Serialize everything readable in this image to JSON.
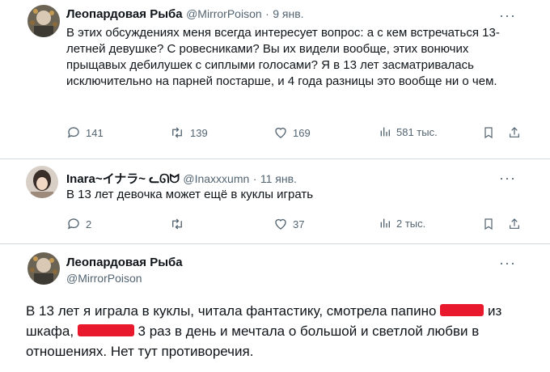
{
  "tweets": [
    {
      "name": "Леопардовая Рыба",
      "handle": "@MirrorPoison",
      "sep": "·",
      "date": "9 янв.",
      "text": "В этих обсуждениях меня всегда интересует вопрос: а с кем встречаться 13-летней девушке? С ровесниками? Вы их видели вообще, этих вонючих прыщавых дебилушек с сиплыми голосами? Я в 13 лет засматривалась исключительно на парней постарше, и 4 года разницы это вообще ни о чем.",
      "replies": "141",
      "retweets": "139",
      "likes": "169",
      "views": "581 тыс."
    },
    {
      "name": "Inara~イナラ~ ᓚᘏᗢ",
      "handle": "@Inaxxxumn",
      "sep": "·",
      "date": "11 янв.",
      "text": "В 13 лет девочка может ещё в куклы играть",
      "replies": "2",
      "retweets": "",
      "likes": "37",
      "views": "2 тыс."
    },
    {
      "name": "Леопардовая Рыба",
      "handle": "@MirrorPoison",
      "text_part1": "В 13 лет я играла в куклы, читала фантастику, смотрела папино",
      "text_part2": "из шкафа,",
      "text_part3": "3 раз в день и мечтала о большой и светлой любви в отношениях. Нет тут противоречия."
    }
  ],
  "more_label": "···",
  "colors": {
    "muted": "#536471",
    "divider": "#cfd9de",
    "redaction": "#e8192c"
  }
}
